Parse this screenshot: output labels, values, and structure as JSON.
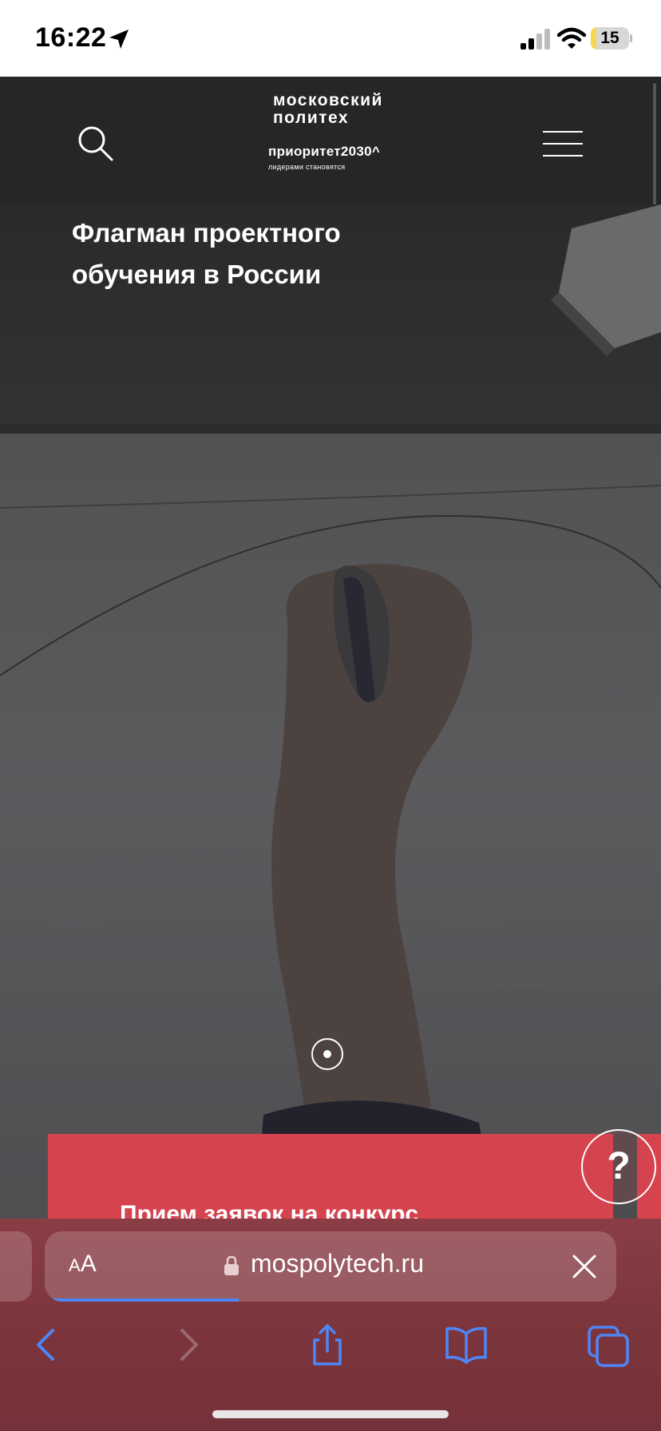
{
  "status_bar": {
    "time": "16:22",
    "battery_level": "15",
    "battery_fraction": 0.15,
    "icons": [
      "location-arrow-icon",
      "signal-icon",
      "wifi-icon",
      "battery-icon"
    ]
  },
  "header": {
    "logo_line1": "московский",
    "logo_line2": "политех",
    "logo_priority": "приоритет2030^",
    "logo_slogan": "лидерами становятся",
    "icons": [
      "search-icon",
      "menu-icon"
    ]
  },
  "hero": {
    "title": "Флагман проектного обучения в России",
    "pager_icon": "slide-indicator-icon"
  },
  "promo": {
    "text": "Прием заявок на конкурс",
    "color": "#d5434f"
  },
  "help": {
    "label": "?"
  },
  "browser": {
    "text_size_label_small": "A",
    "text_size_label_big": "A",
    "url": "mospolytech.ru",
    "load_progress": 0.34,
    "accent": "#4f86f7",
    "icons": [
      "lock-icon",
      "close-icon",
      "back-icon",
      "forward-icon",
      "share-icon",
      "bookmarks-icon",
      "tabs-icon"
    ]
  }
}
